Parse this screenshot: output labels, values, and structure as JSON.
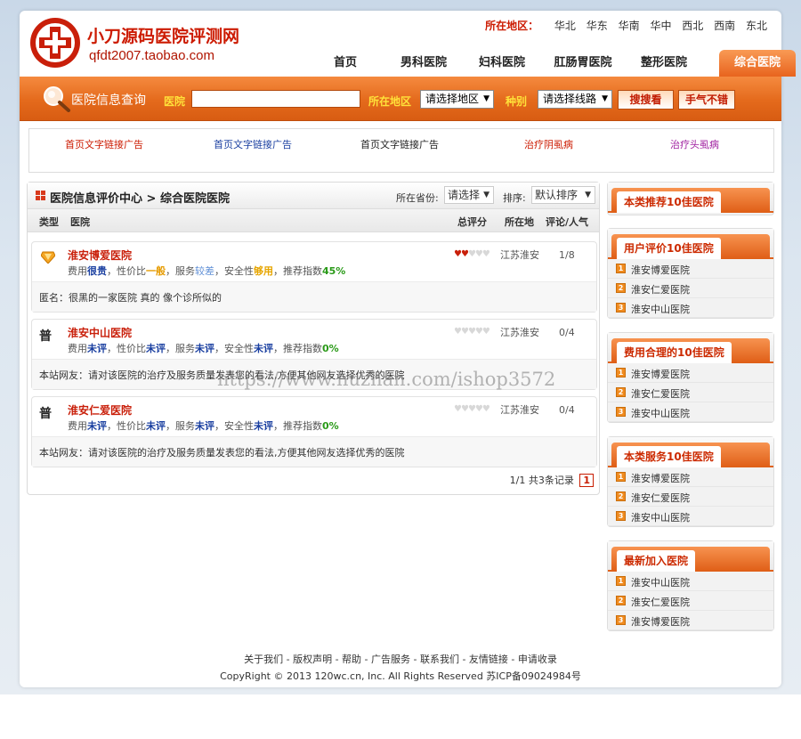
{
  "header": {
    "site_title": "小刀源码医院评测网",
    "site_sub": "qfdt2007.taobao.com",
    "region_label": "所在地区：",
    "regions": [
      "华北",
      "华东",
      "华南",
      "华中",
      "西北",
      "西南",
      "东北"
    ],
    "nav": [
      "首页",
      "男科医院",
      "妇科医院",
      "肛肠胃医院",
      "整形医院",
      "综合医院"
    ]
  },
  "search": {
    "title": "医院信息查询",
    "hospital_label": "医院",
    "hospital_value": "",
    "area_label": "所在地区",
    "area_select": "请选择地区",
    "type_label": "种别",
    "type_select": "请选择线路",
    "search_btn": "搜搜看",
    "lucky_btn": "手气不错"
  },
  "ads": [
    {
      "text": "首页文字链接广告",
      "color": "#cc1a00"
    },
    {
      "text": "首页文字链接广告",
      "color": "#1a3fa0"
    },
    {
      "text": "首页文字链接广告",
      "color": "#222222"
    },
    {
      "text": "治疗阴虱病",
      "color": "#cc1a00"
    },
    {
      "text": "治疗头虱病",
      "color": "#a020a0"
    }
  ],
  "main": {
    "breadcrumb": "医院信息评价中心  > 综合医院医院",
    "province_label": "所在省份:",
    "province_select": "请选择",
    "sort_label": "排序:",
    "sort_select": "默认排序",
    "columns": {
      "type": "类型",
      "hospital": "医院",
      "score": "总评分",
      "location": "所在地",
      "comments": "评论/人气"
    },
    "items": [
      {
        "badge": "",
        "name": "淮安博爱医院",
        "cost_label": "费用",
        "cost": "很贵",
        "value_label": "，性价比",
        "value": "一般",
        "service_label": "，服务",
        "service": "较差",
        "safety_label": "，安全性",
        "safety": "够用",
        "rec_label": "，推荐指数",
        "rec": "45%",
        "hearts_filled": 2,
        "location": "江苏淮安",
        "count": "1/8",
        "comment": "匿名：很黑的一家医院  真的  像个诊所似的"
      },
      {
        "badge": "普",
        "name": "淮安中山医院",
        "cost_label": "费用",
        "cost": "未评",
        "value_label": "，性价比",
        "value": "未评",
        "service_label": "，服务",
        "service": "未评",
        "safety_label": "，安全性",
        "safety": "未评",
        "rec_label": "，推荐指数",
        "rec": "0%",
        "hearts_filled": 0,
        "location": "江苏淮安",
        "count": "0/4",
        "comment": "本站网友：请对该医院的治疗及服务质量发表您的看法,方便其他网友选择优秀的医院"
      },
      {
        "badge": "普",
        "name": "淮安仁爱医院",
        "cost_label": "费用",
        "cost": "未评",
        "value_label": "，性价比",
        "value": "未评",
        "service_label": "，服务",
        "service": "未评",
        "safety_label": "，安全性",
        "safety": "未评",
        "rec_label": "，推荐指数",
        "rec": "0%",
        "hearts_filled": 0,
        "location": "江苏淮安",
        "count": "0/4",
        "comment": "本站网友：请对该医院的治疗及服务质量发表您的看法,方便其他网友选择优秀的医院"
      }
    ],
    "pager_text": "1/1 共3条记录",
    "pager_page": "1"
  },
  "sidebar": [
    {
      "title": "本类推荐10佳医院",
      "items": []
    },
    {
      "title": "用户评价10佳医院",
      "items": [
        "淮安博爱医院",
        "淮安仁爱医院",
        "淮安中山医院"
      ]
    },
    {
      "title": "费用合理的10佳医院",
      "items": [
        "淮安博爱医院",
        "淮安仁爱医院",
        "淮安中山医院"
      ]
    },
    {
      "title": "本类服务10佳医院",
      "items": [
        "淮安博爱医院",
        "淮安仁爱医院",
        "淮安中山医院"
      ]
    },
    {
      "title": "最新加入医院",
      "items": [
        "淮安中山医院",
        "淮安仁爱医院",
        "淮安博爱医院"
      ]
    }
  ],
  "footer": {
    "links": "关于我们  - 版权声明  - 帮助  - 广告服务  - 联系我们  - 友情链接  - 申请收录",
    "copyright": "CopyRight © 2013 120wc.cn, Inc. All Rights Reserved 苏ICP备09024984号"
  },
  "watermark": "https://www.huzhan.com/ishop3572"
}
